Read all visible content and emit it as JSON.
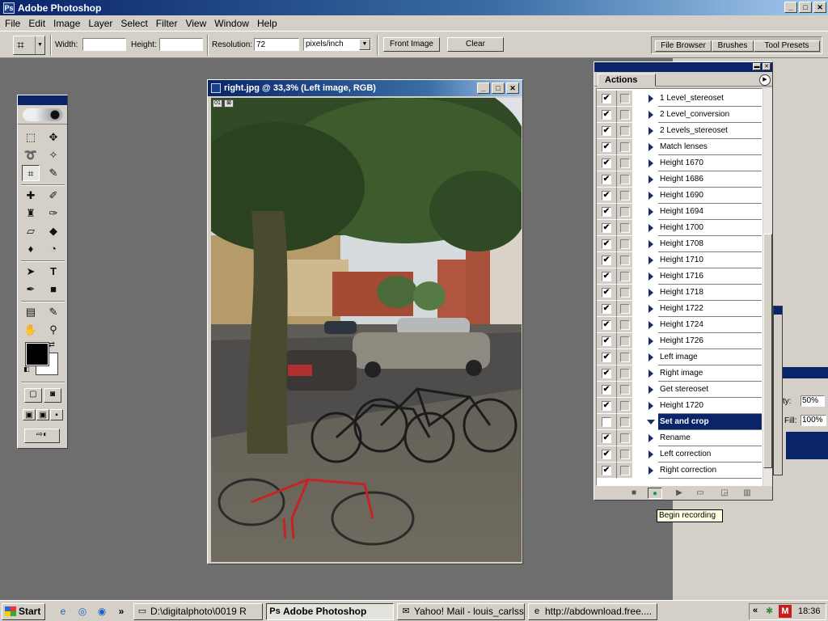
{
  "app": {
    "title": "Adobe Photoshop",
    "icon": "photoshop-icon"
  },
  "window_controls": {
    "minimize": "_",
    "maximize": "□",
    "close": "✕"
  },
  "menu": [
    "File",
    "Edit",
    "Image",
    "Layer",
    "Select",
    "Filter",
    "View",
    "Window",
    "Help"
  ],
  "options_bar": {
    "width_label": "Width:",
    "width_value": "",
    "height_label": "Height:",
    "height_value": "",
    "resolution_label": "Resolution:",
    "resolution_value": "72",
    "units": "pixels/inch",
    "front_image": "Front Image",
    "clear": "Clear"
  },
  "palette_well": [
    "File Browser",
    "Brushes",
    "Tool Presets"
  ],
  "document": {
    "title": "right.jpg @ 33,3% (Left image, RGB)"
  },
  "actions_panel": {
    "tab": "Actions",
    "items": [
      {
        "label": "1 Level_stereoset",
        "checked": true,
        "expanded": false,
        "selected": false
      },
      {
        "label": "2 Level_conversion",
        "checked": true,
        "expanded": false,
        "selected": false
      },
      {
        "label": "2 Levels_stereoset",
        "checked": true,
        "expanded": false,
        "selected": false
      },
      {
        "label": "Match lenses",
        "checked": true,
        "expanded": false,
        "selected": false
      },
      {
        "label": "Height 1670",
        "checked": true,
        "expanded": false,
        "selected": false
      },
      {
        "label": "Height 1686",
        "checked": true,
        "expanded": false,
        "selected": false
      },
      {
        "label": "Height 1690",
        "checked": true,
        "expanded": false,
        "selected": false
      },
      {
        "label": "Height 1694",
        "checked": true,
        "expanded": false,
        "selected": false
      },
      {
        "label": "Height 1700",
        "checked": true,
        "expanded": false,
        "selected": false
      },
      {
        "label": "Height 1708",
        "checked": true,
        "expanded": false,
        "selected": false
      },
      {
        "label": "Height 1710",
        "checked": true,
        "expanded": false,
        "selected": false
      },
      {
        "label": "Height 1716",
        "checked": true,
        "expanded": false,
        "selected": false
      },
      {
        "label": "Height 1718",
        "checked": true,
        "expanded": false,
        "selected": false
      },
      {
        "label": "Height 1722",
        "checked": true,
        "expanded": false,
        "selected": false
      },
      {
        "label": "Height 1724",
        "checked": true,
        "expanded": false,
        "selected": false
      },
      {
        "label": "Height 1726",
        "checked": true,
        "expanded": false,
        "selected": false
      },
      {
        "label": "Left image",
        "checked": true,
        "expanded": false,
        "selected": false
      },
      {
        "label": "Right image",
        "checked": true,
        "expanded": false,
        "selected": false
      },
      {
        "label": "Get stereoset",
        "checked": true,
        "expanded": false,
        "selected": false
      },
      {
        "label": "Height 1720",
        "checked": true,
        "expanded": false,
        "selected": false
      },
      {
        "label": "Set and crop",
        "checked": false,
        "expanded": true,
        "selected": true
      },
      {
        "label": "Rename",
        "checked": true,
        "expanded": false,
        "selected": false
      },
      {
        "label": "Left correction",
        "checked": true,
        "expanded": false,
        "selected": false
      },
      {
        "label": "Right correction",
        "checked": true,
        "expanded": false,
        "selected": false
      }
    ]
  },
  "tooltip": "Begin recording",
  "layers_fragment": {
    "opacity_label": "ty:",
    "opacity_value": "50%",
    "fill_label": "Fill:",
    "fill_value": "100%"
  },
  "taskbar": {
    "start": "Start",
    "quick_launch_more": "»",
    "tasks": [
      {
        "label": "D:\\digitalphoto\\0019 R",
        "icon": "folder-icon",
        "active": false
      },
      {
        "label": "Adobe Photoshop",
        "icon": "photoshop-icon",
        "active": true
      },
      {
        "label": "Yahoo! Mail - louis_carlss...",
        "icon": "mail-icon",
        "active": false
      },
      {
        "label": "http://abdownload.free....",
        "icon": "browser-icon",
        "active": false
      }
    ],
    "tray_arrow": "«",
    "clock": "18:36"
  },
  "colors": {
    "title_gradient_start": "#0a246a",
    "title_gradient_end": "#a6caf0",
    "chrome": "#d4d0c8",
    "workspace": "#6e6e6e",
    "selection": "#0a246a"
  }
}
